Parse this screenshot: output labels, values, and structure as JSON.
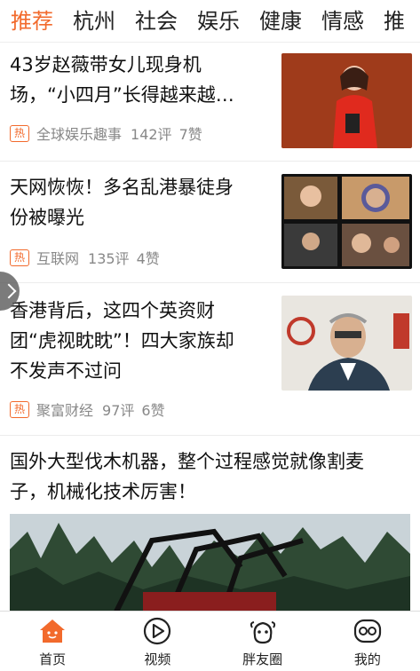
{
  "tabs": [
    {
      "label": "推荐",
      "active": true
    },
    {
      "label": "杭州"
    },
    {
      "label": "社会"
    },
    {
      "label": "娱乐"
    },
    {
      "label": "健康"
    },
    {
      "label": "情感"
    },
    {
      "label": "推"
    }
  ],
  "articles": [
    {
      "title_line1": "43岁赵薇带女儿现身机",
      "title_line2": "场，“小四月”长得越来越…",
      "badge": "热",
      "source": "全球娱乐趣事",
      "comments": "142评",
      "likes": "7赞"
    },
    {
      "title_line1": "天网恢恢！多名乱港暴徒身",
      "title_line2": "份被曝光",
      "badge": "热",
      "source": "互联网",
      "comments": "135评",
      "likes": "4赞"
    },
    {
      "title_line1": "香港背后，这四个英资财",
      "title_line2": "团“虎视眈眈”！四大家族却",
      "title_line3": "不发声不过问",
      "badge": "热",
      "source": "聚富财经",
      "comments": "97评",
      "likes": "6赞"
    },
    {
      "title_line1": "国外大型伐木机器，整个过程感觉就像割麦",
      "title_line2": "子，机械化技术厉害！"
    }
  ],
  "bottom_nav": [
    {
      "label": "首页",
      "icon": "home-icon",
      "active": true
    },
    {
      "label": "视频",
      "icon": "video-icon"
    },
    {
      "label": "胖友圈",
      "icon": "friends-icon"
    },
    {
      "label": "我的",
      "icon": "profile-icon"
    }
  ],
  "colors": {
    "accent": "#f26a2c"
  }
}
